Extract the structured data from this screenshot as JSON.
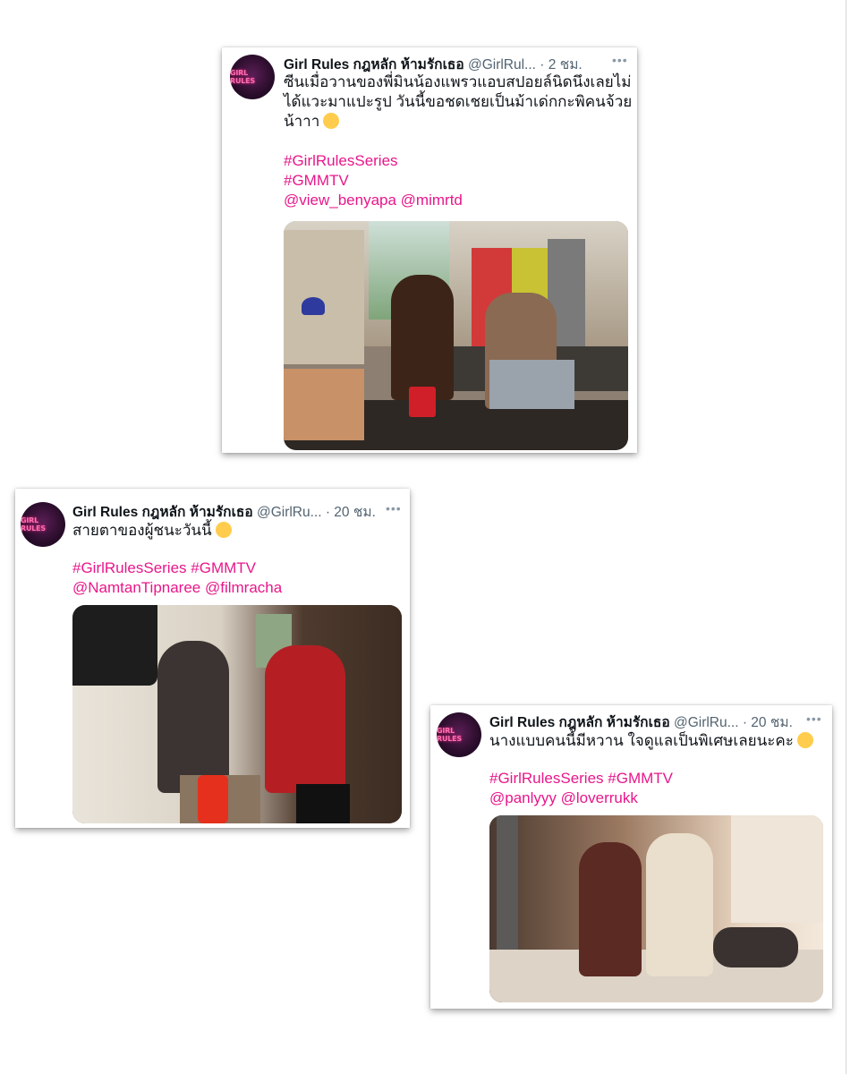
{
  "cards": [
    {
      "display_name": "Girl Rules กฎหลัก ห้ามรักเธอ",
      "handle": "@GirlRul...",
      "time": "· 2 ชม.",
      "avatar_text": "GIRL RULES",
      "text_lines": [
        "ซีนเมื่อวานของพี่มินน้องแพรวแอบสปอยล์นิดนึงเลยไม่",
        "ได้แวะมาแปะรูป วันนี้ขอชดเชยเป็นม้าเด่กกะพิคนจ้วย",
        "น้าาา"
      ],
      "hashtags": [
        "#GirlRulesSeries",
        "#GMMTV"
      ],
      "mentions": "@view_benyapa @mimrtd",
      "emoji": "kissing-face-emoji",
      "image": "photo-two-women-at-desk-with-laptop-and-red-mug"
    },
    {
      "display_name": "Girl Rules กฎหลัก ห้ามรักเธอ",
      "handle": "@GirlRu...",
      "time": "· 20 ชม.",
      "avatar_text": "GIRL RULES",
      "text_lines": [
        "สายตาของผู้ชนะวันนี้"
      ],
      "hashtags": [
        "#GirlRulesSeries #GMMTV"
      ],
      "mentions": "@NamtanTipnaree @filmracha",
      "emoji": "smirking-face-emoji",
      "image": "photo-two-women-seated-with-camera-rig"
    },
    {
      "display_name": "Girl Rules กฎหลัก ห้ามรักเธอ",
      "handle": "@GirlRu...",
      "time": "· 20 ชม.",
      "avatar_text": "GIRL RULES",
      "text_lines": [
        "นางแบบคนนี้มีหวาน ใจดูแลเป็นพิเศษเลยนะคะ"
      ],
      "hashtags": [
        "#GirlRulesSeries #GMMTV"
      ],
      "mentions": "@panlyyy @loverrukk",
      "emoji": "grinning-face-emoji",
      "image": "photo-two-women-on-bed"
    }
  ],
  "colors": {
    "accent_hashtag": "#e8178a",
    "secondary_text": "#536471"
  }
}
